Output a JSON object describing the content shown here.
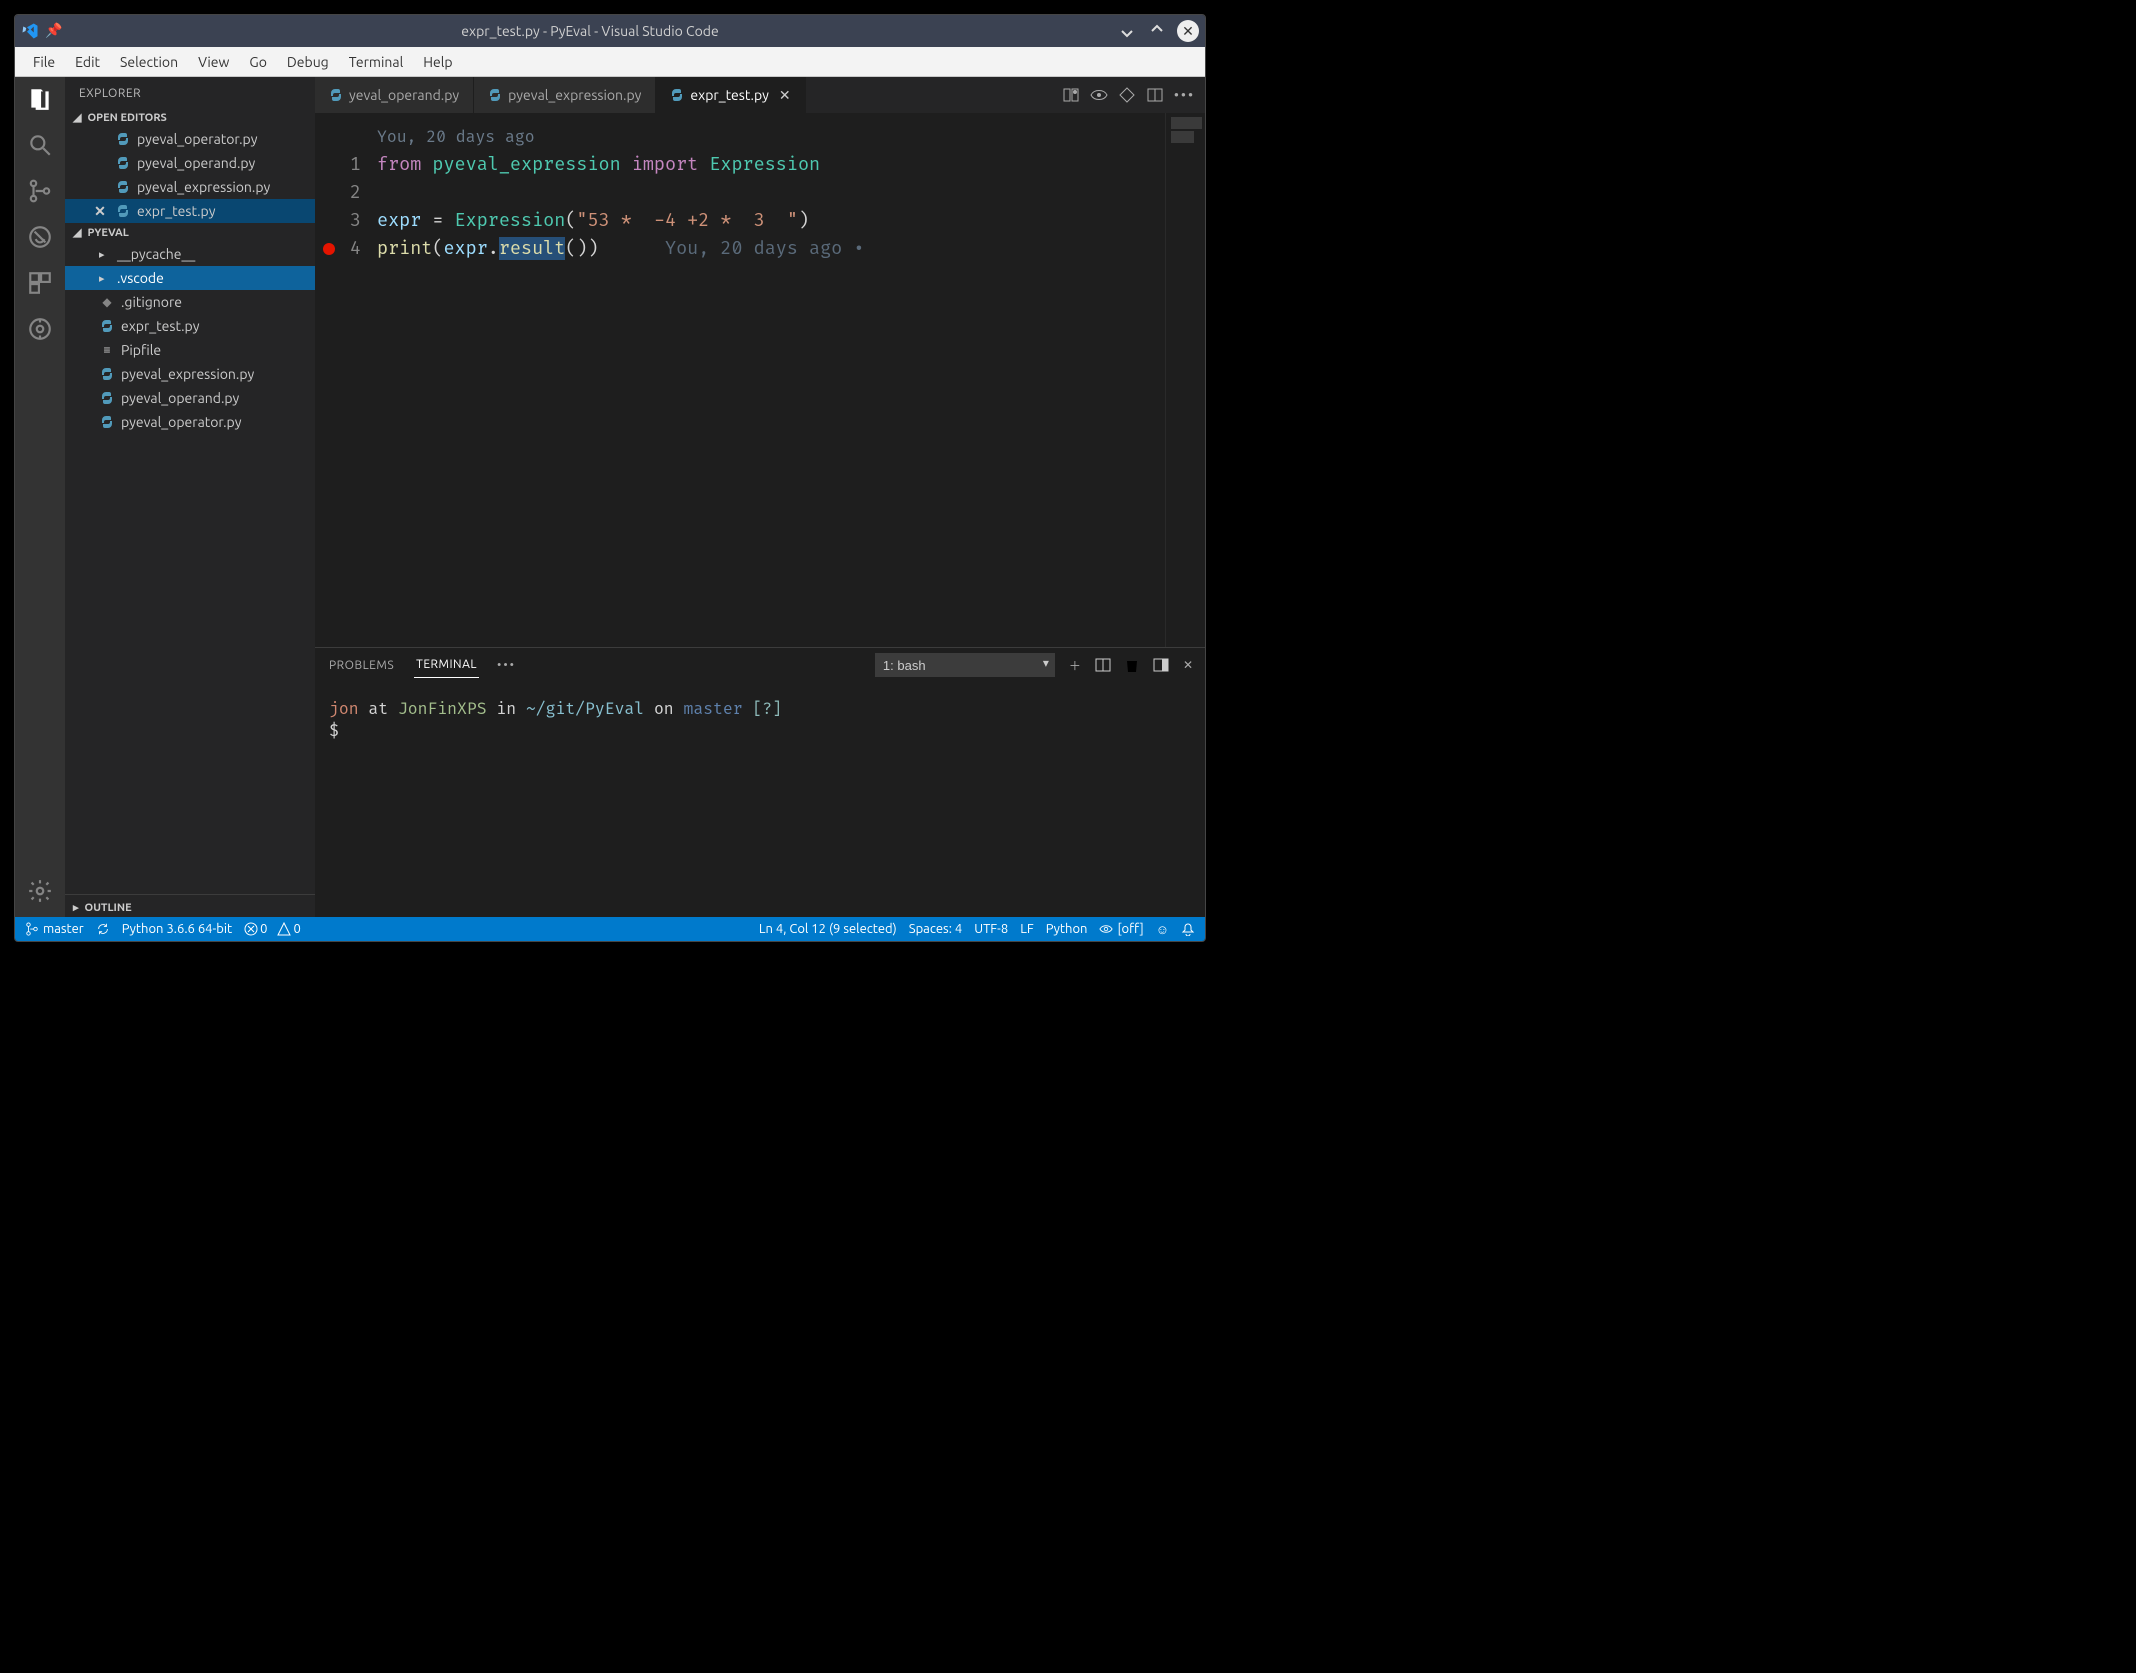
{
  "window": {
    "title": "expr_test.py - PyEval - Visual Studio Code"
  },
  "menu": [
    "File",
    "Edit",
    "Selection",
    "View",
    "Go",
    "Debug",
    "Terminal",
    "Help"
  ],
  "sidebar": {
    "title": "EXPLORER",
    "open_editors_label": "OPEN EDITORS",
    "open_editors": [
      {
        "name": "pyeval_operator.py",
        "modified": false
      },
      {
        "name": "pyeval_operand.py",
        "modified": false
      },
      {
        "name": "pyeval_expression.py",
        "modified": false
      },
      {
        "name": "expr_test.py",
        "modified": false,
        "active": true
      }
    ],
    "project_label": "PYEVAL",
    "tree": [
      {
        "type": "folder",
        "name": "__pycache__",
        "collapsed": true
      },
      {
        "type": "folder",
        "name": ".vscode",
        "collapsed": true,
        "selected": true
      },
      {
        "type": "file",
        "name": ".gitignore",
        "icon": "git"
      },
      {
        "type": "file",
        "name": "expr_test.py",
        "icon": "py"
      },
      {
        "type": "file",
        "name": "Pipfile",
        "icon": "pip"
      },
      {
        "type": "file",
        "name": "pyeval_expression.py",
        "icon": "py"
      },
      {
        "type": "file",
        "name": "pyeval_operand.py",
        "icon": "py"
      },
      {
        "type": "file",
        "name": "pyeval_operator.py",
        "icon": "py"
      }
    ],
    "outline_label": "OUTLINE"
  },
  "tabs": [
    {
      "name": "yeval_operand.py",
      "active": false,
      "truncated": true
    },
    {
      "name": "pyeval_expression.py",
      "active": false
    },
    {
      "name": "expr_test.py",
      "active": true
    }
  ],
  "editor_lens": "You, 20 days ago",
  "code": {
    "lines": [
      {
        "n": 1,
        "tokens": [
          {
            "t": "from ",
            "c": "k-from"
          },
          {
            "t": "pyeval_expression",
            "c": "k-mod"
          },
          {
            "t": " import ",
            "c": "k-import"
          },
          {
            "t": "Expression",
            "c": "k-cls"
          }
        ]
      },
      {
        "n": 2,
        "tokens": [
          {
            "t": " ",
            "c": ""
          }
        ]
      },
      {
        "n": 3,
        "tokens": [
          {
            "t": "expr",
            "c": "k-var"
          },
          {
            "t": " = ",
            "c": "k-op"
          },
          {
            "t": "Expression",
            "c": "k-cls"
          },
          {
            "t": "(",
            "c": "k-op"
          },
          {
            "t": "\"53 *  -4 +2 *  3  \"",
            "c": "k-str"
          },
          {
            "t": ")",
            "c": "k-op"
          }
        ]
      },
      {
        "n": 4,
        "bp": true,
        "tokens": [
          {
            "t": "print",
            "c": "k-fn"
          },
          {
            "t": "(",
            "c": "k-op"
          },
          {
            "t": "expr",
            "c": "k-var"
          },
          {
            "t": ".",
            "c": "k-op"
          },
          {
            "t": "result",
            "c": "k-fn",
            "sel": true
          },
          {
            "t": "()",
            "c": "k-op"
          },
          {
            "t": ")",
            "c": "k-op"
          }
        ],
        "blame": "      You, 20 days ago •"
      }
    ]
  },
  "panel": {
    "tabs": [
      "PROBLEMS",
      "TERMINAL"
    ],
    "active_tab": "TERMINAL",
    "terminal_selector": "1: bash",
    "terminal": {
      "user": "jon",
      "at": " at ",
      "host": "JonFinXPS",
      "in": " in ",
      "path": "~/git/PyEval",
      "on": " on ",
      "branch": "master",
      "flag": " [?]",
      "prompt": "$"
    }
  },
  "status": {
    "branch": "master",
    "python": "Python 3.6.6 64-bit",
    "errors": "0",
    "warnings": "0",
    "cursor": "Ln 4, Col 12 (9 selected)",
    "spaces": "Spaces: 4",
    "encoding": "UTF-8",
    "eol": "LF",
    "lang": "Python",
    "off": "[off]"
  }
}
